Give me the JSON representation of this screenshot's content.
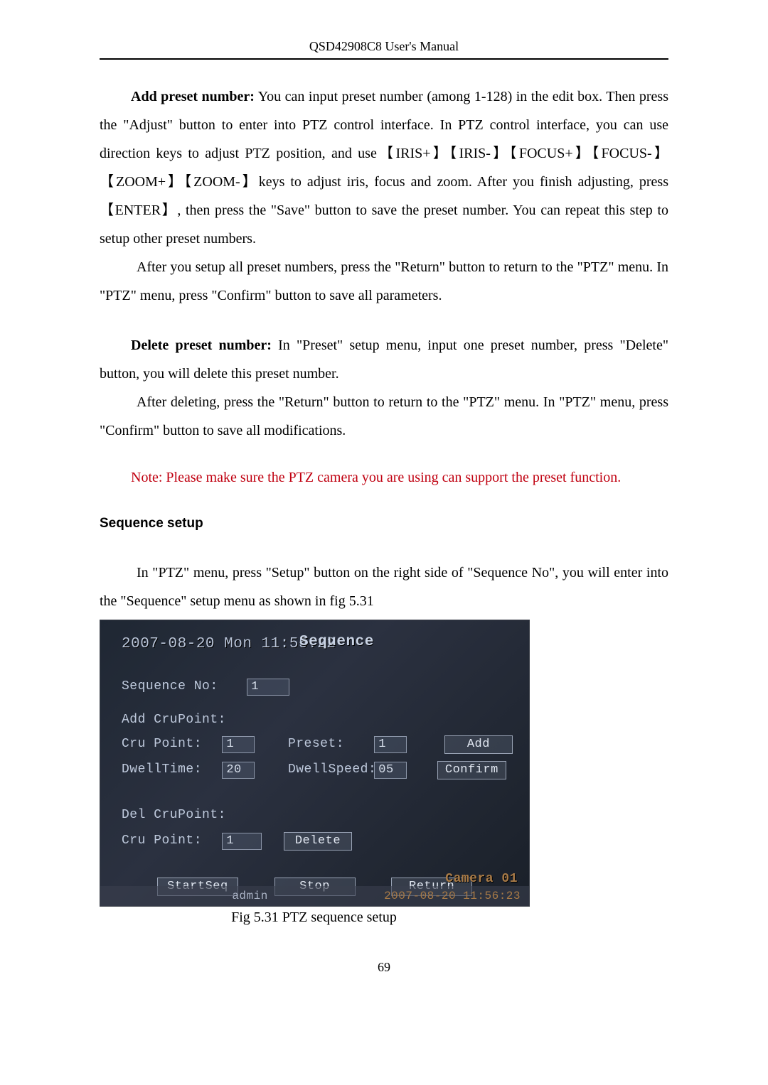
{
  "running_head": "QSD42908C8 User's Manual",
  "para1_lead_bold": "Add preset number:",
  "para1": " You can input preset number (among 1-128) in the edit box. Then press the \"Adjust\" button to enter into PTZ control interface. In PTZ control interface, you can use direction keys to adjust PTZ position, and use【IRIS+】【IRIS-】【FOCUS+】【FOCUS-】【ZOOM+】【ZOOM-】keys to adjust iris, focus and zoom. After you finish adjusting, press【ENTER】, then press the \"Save\" button to save the preset number. You can repeat this step to setup other preset numbers.",
  "para2": "After you setup all preset numbers, press the \"Return\" button to return to the \"PTZ\" menu. In \"PTZ\" menu, press \"Confirm\" button to save all parameters.",
  "para3_lead_bold": "Delete preset number:",
  "para3": " In \"Preset\" setup menu, input one preset number, press \"Delete\" button, you will delete this preset number.",
  "para4": "After deleting, press the \"Return\" button to return to the \"PTZ\" menu. In \"PTZ\" menu, press \"Confirm\" button to save all modifications.",
  "note_red": "Note: Please make sure the PTZ camera you are using can support the preset function.",
  "sequence_heading": "Sequence setup",
  "para5": "In \"PTZ\" menu, press \"Setup\" button on the right side of \"Sequence No\", you will enter into the \"Sequence\" setup menu as shown in fig 5.31",
  "fig_caption": "Fig 5.31 PTZ sequence setup",
  "page_number": "69",
  "screenshot": {
    "datetime_top": "2007-08-20 Mon 11:55:22",
    "title": "Sequence",
    "labels": {
      "sequence_no": "Sequence No:",
      "add_crupoint": "Add CruPoint:",
      "cru_point": "Cru Point:",
      "preset": "Preset:",
      "dwelltime": "DwellTime:",
      "dwellspeed": "DwellSpeed:",
      "del_crupoint": "Del CruPoint:",
      "del_cru_point": "Cru Point:"
    },
    "values": {
      "sequence_no": "1",
      "cru_point": "1",
      "preset": "1",
      "dwelltime": "20",
      "dwellspeed": "05",
      "del_cru_point": "1"
    },
    "buttons": {
      "add": "Add",
      "confirm": "Confirm",
      "delete": "Delete",
      "startseq": "StartSeq",
      "stop": "Stop",
      "return": "Return"
    },
    "footer": {
      "user": "admin",
      "datetime": "2007-08-20 11:56:23",
      "camera": "Camera 01"
    }
  }
}
